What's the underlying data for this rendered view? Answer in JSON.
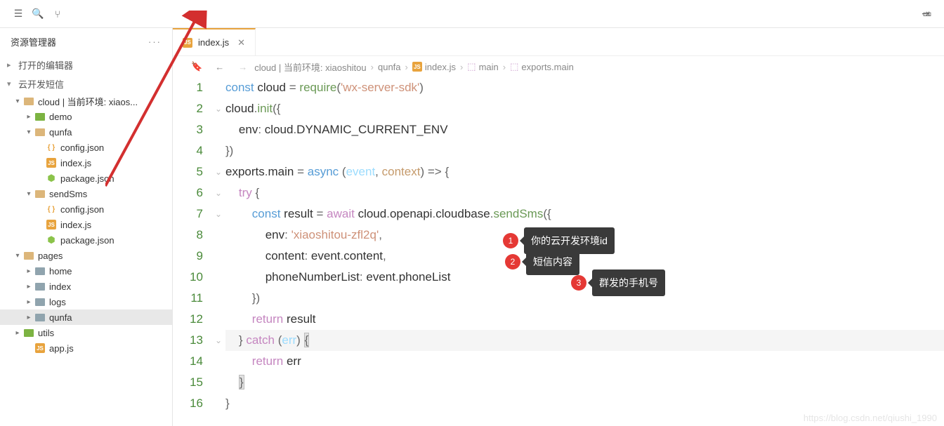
{
  "toolbar": {
    "icons": [
      "list-icon",
      "search-icon",
      "branch-icon",
      "panel-icon",
      "layout-icon"
    ]
  },
  "sidebar": {
    "title": "资源管理器",
    "sections": {
      "opened_editors": "打开的编辑器",
      "project": "云开发短信"
    },
    "tree": [
      {
        "depth": 0,
        "chev": "▾",
        "icon": "folder-orange",
        "label": "cloud | 当前环境: xiaos...",
        "sel": false
      },
      {
        "depth": 1,
        "chev": "▸",
        "icon": "folder-green",
        "label": "demo",
        "sel": false
      },
      {
        "depth": 1,
        "chev": "▾",
        "icon": "folder-orange",
        "label": "qunfa",
        "sel": false
      },
      {
        "depth": 2,
        "chev": "",
        "icon": "file-json",
        "label": "config.json",
        "sel": false
      },
      {
        "depth": 2,
        "chev": "",
        "icon": "file-js",
        "label": "index.js",
        "sel": false
      },
      {
        "depth": 2,
        "chev": "",
        "icon": "file-node",
        "label": "package.json",
        "sel": false
      },
      {
        "depth": 1,
        "chev": "▾",
        "icon": "folder-orange",
        "label": "sendSms",
        "sel": false
      },
      {
        "depth": 2,
        "chev": "",
        "icon": "file-json",
        "label": "config.json",
        "sel": false
      },
      {
        "depth": 2,
        "chev": "",
        "icon": "file-js",
        "label": "index.js",
        "sel": false
      },
      {
        "depth": 2,
        "chev": "",
        "icon": "file-node",
        "label": "package.json",
        "sel": false
      },
      {
        "depth": 0,
        "chev": "▾",
        "icon": "folder-orange",
        "label": "pages",
        "sel": false
      },
      {
        "depth": 1,
        "chev": "▸",
        "icon": "folder-gray",
        "label": "home",
        "sel": false
      },
      {
        "depth": 1,
        "chev": "▸",
        "icon": "folder-gray",
        "label": "index",
        "sel": false
      },
      {
        "depth": 1,
        "chev": "▸",
        "icon": "folder-gray",
        "label": "logs",
        "sel": false
      },
      {
        "depth": 1,
        "chev": "▸",
        "icon": "folder-gray",
        "label": "qunfa",
        "sel": true
      },
      {
        "depth": 0,
        "chev": "▸",
        "icon": "folder-green",
        "label": "utils",
        "sel": false
      },
      {
        "depth": 1,
        "chev": "",
        "icon": "file-js",
        "label": "app.js",
        "sel": false
      }
    ]
  },
  "tab": {
    "filename": "index.js"
  },
  "breadcrumb": {
    "parts": [
      "cloud | 当前环境: xiaoshitou",
      "qunfa",
      "index.js",
      "main",
      "exports.main"
    ]
  },
  "annotations": {
    "a1": "你的云开发环境id",
    "a2": "短信内容",
    "a3": "群发的手机号"
  },
  "code": {
    "l1": "const cloud = require('wx-server-sdk')",
    "l2": "cloud.init({",
    "l3": "    env: cloud.DYNAMIC_CURRENT_ENV",
    "l4": "})",
    "l5": "exports.main = async (event, context) => {",
    "l6": "    try {",
    "l7": "        const result = await cloud.openapi.cloudbase.sendSms({",
    "l8": "            env: 'xiaoshitou-zfl2q',",
    "l9": "            content: event.content,",
    "l10": "            phoneNumberList: event.phoneList",
    "l11": "        })",
    "l12": "        return result",
    "l13": "    } catch (err) {",
    "l14": "        return err",
    "l15": "    }",
    "l16": "}"
  },
  "watermark": "https://blog.csdn.net/qiushi_1990"
}
